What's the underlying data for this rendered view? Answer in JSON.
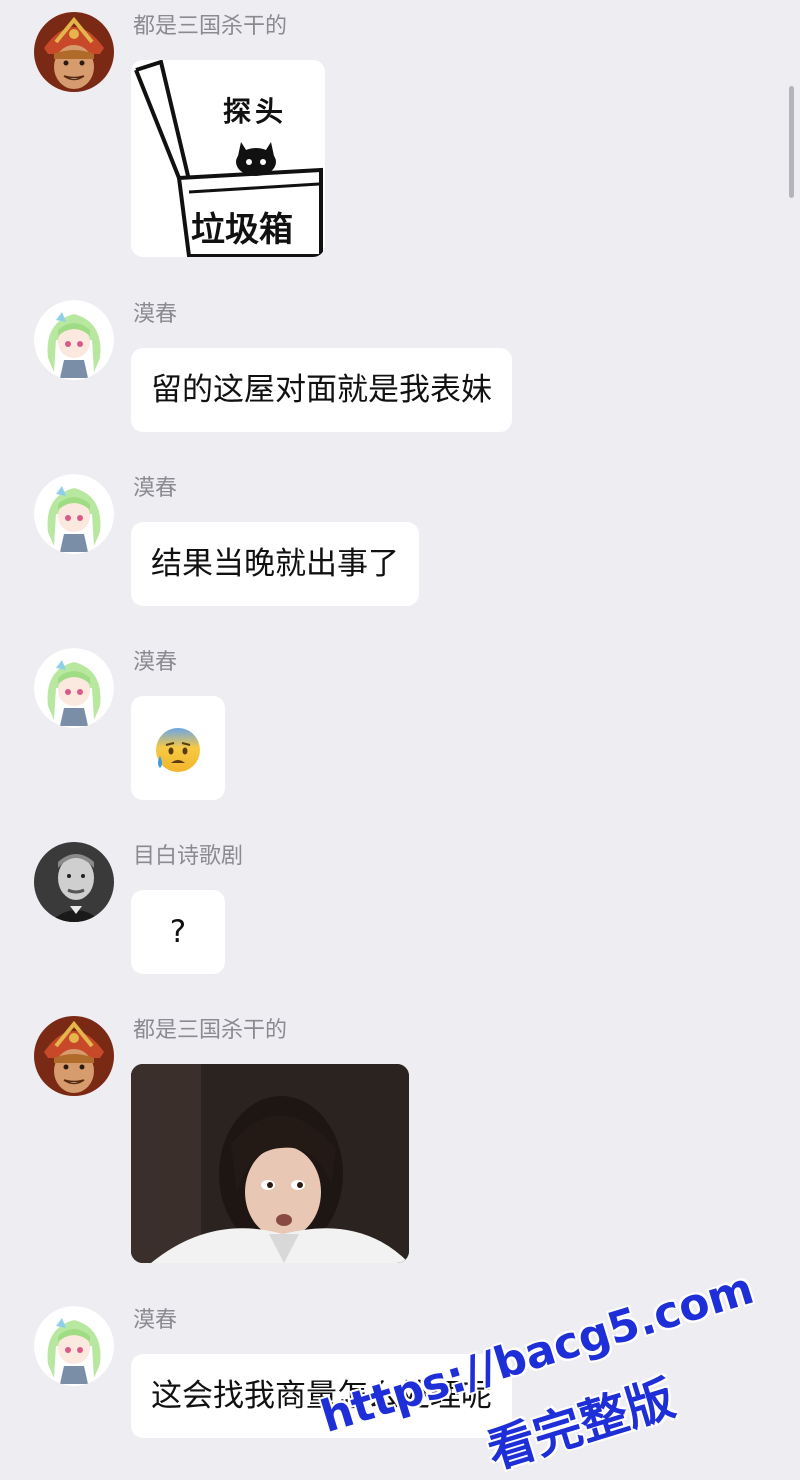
{
  "messages": [
    {
      "sender": "都是三国杀干的",
      "type": "sticker",
      "sticker_text_top": "探头",
      "sticker_text_box": "垃圾箱"
    },
    {
      "sender": "漠春",
      "type": "text",
      "text": "留的这屋对面就是我表妹"
    },
    {
      "sender": "漠春",
      "type": "text",
      "text": "结果当晚就出事了"
    },
    {
      "sender": "漠春",
      "type": "emoji",
      "text": "😰"
    },
    {
      "sender": "目白诗歌剧",
      "type": "text",
      "text": "?"
    },
    {
      "sender": "都是三国杀干的",
      "type": "image"
    },
    {
      "sender": "漠春",
      "type": "text",
      "text": "这会找我商量怎么处理呢"
    }
  ],
  "watermark": {
    "url": "https://bacg5.com",
    "caption": "看完整版",
    "color": "#1f2fd8"
  },
  "colors": {
    "background": "#ededf2",
    "bubble": "#ffffff",
    "sender_name": "#8a8a90"
  }
}
